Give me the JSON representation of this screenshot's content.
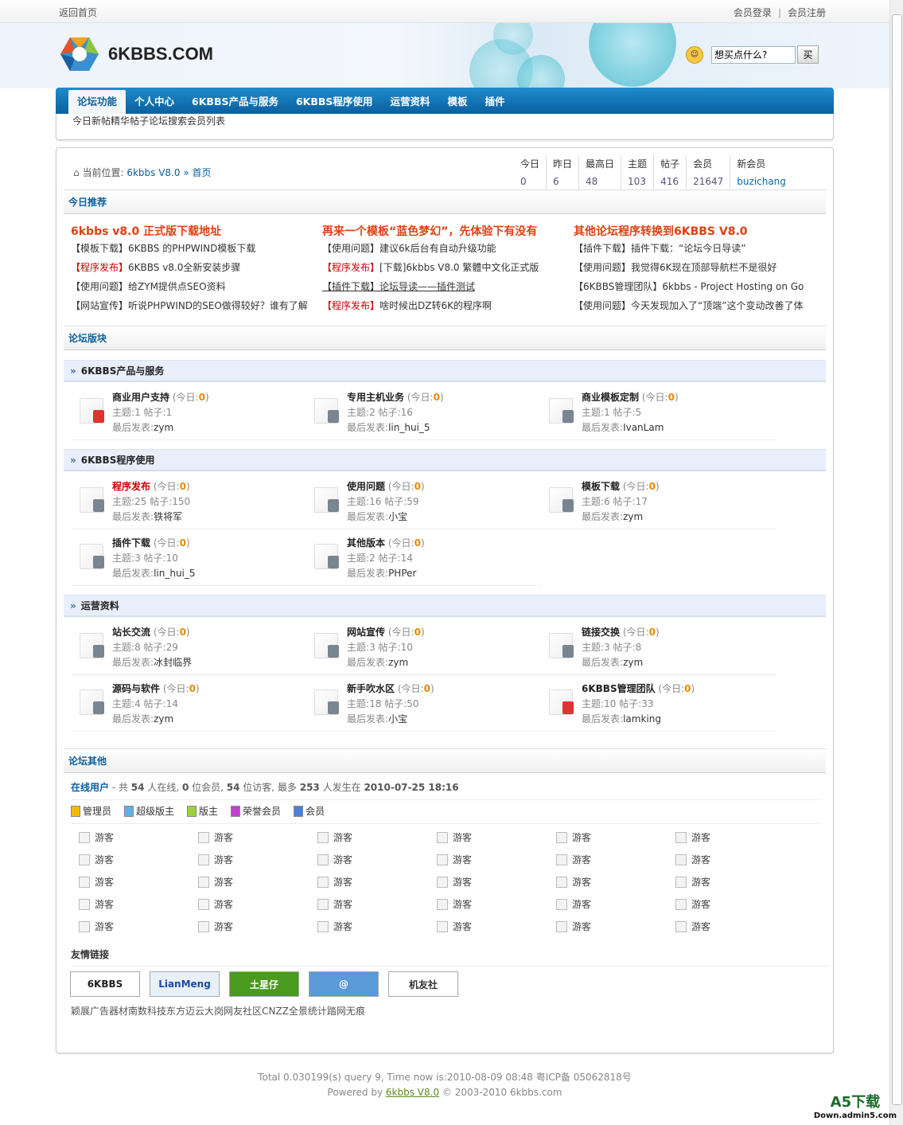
{
  "topbar": {
    "home": "返回首页",
    "login": "会员登录",
    "sep": "|",
    "register": "会员注册"
  },
  "logo": {
    "text": "6KBBS.COM"
  },
  "search": {
    "placeholder": "想买点什么?",
    "button": "买"
  },
  "nav": [
    "论坛功能",
    "个人中心",
    "6KBBS产品与服务",
    "6KBBS程序使用",
    "运营资料",
    "模板",
    "插件"
  ],
  "subnav": [
    "今日新帖",
    "精华帖子",
    "论坛搜索",
    "会员列表"
  ],
  "breadcrumb": {
    "label": "当前位置:",
    "site": "6kbbs V8.0",
    "sep": "»",
    "page": "首页"
  },
  "stats": [
    {
      "k": "今日",
      "v": "0"
    },
    {
      "k": "昨日",
      "v": "6"
    },
    {
      "k": "最高日",
      "v": "48"
    },
    {
      "k": "主题",
      "v": "103"
    },
    {
      "k": "帖子",
      "v": "416"
    },
    {
      "k": "会员",
      "v": "21647"
    },
    {
      "k": "新会员",
      "v": "buzichang"
    }
  ],
  "today_title": "今日推荐",
  "recommend": [
    {
      "title": "6kbbs v8.0 正式版下载地址",
      "items": [
        {
          "tag": "【模板下载】",
          "text": "6KBBS 的PHPWIND模板下载"
        },
        {
          "tag": "【程序发布】",
          "text": "6KBBS v8.0全新安装步骤",
          "red": true
        },
        {
          "tag": "【使用问题】",
          "text": "给ZYM提供点SEO资料"
        },
        {
          "tag": "【网站宣传】",
          "text": "听说PHPWIND的SEO做得较好？谁有了解"
        }
      ]
    },
    {
      "title": "再来一个模板“蓝色梦幻”，先体验下有没有",
      "items": [
        {
          "tag": "【使用问题】",
          "text": "建议6k后台有自动升级功能"
        },
        {
          "tag": "【程序发布】",
          "text": "[下载]6kbbs V8.0 繁體中文化正式版",
          "red": true
        },
        {
          "tag": "【插件下载】",
          "text": "论坛导读——插件测试",
          "ul": true
        },
        {
          "tag": "【程序发布】",
          "text": "啥时候出DZ转6K的程序啊",
          "red": true
        }
      ]
    },
    {
      "title": "其他论坛程序转换到6KBBS V8.0",
      "items": [
        {
          "tag": "【插件下载】",
          "text": "插件下载：“论坛今日导读”"
        },
        {
          "tag": "【使用问题】",
          "text": "我觉得6K现在顶部导航栏不是很好"
        },
        {
          "tag": "【6KBBS管理团队】",
          "text": "6kbbs - Project Hosting on Go"
        },
        {
          "tag": "【使用问题】",
          "text": "今天发现加入了“顶端”这个变动改善了体"
        }
      ]
    }
  ],
  "forums_title": "论坛版块",
  "labels": {
    "today": "今日",
    "topics": "主题",
    "posts": "帖子",
    "last": "最后发表"
  },
  "categories": [
    {
      "name": "6KBBS产品与服务",
      "forums": [
        {
          "name": "商业用户支持",
          "today": "0",
          "topics": "1",
          "posts": "1",
          "last": "zym",
          "locked": true
        },
        {
          "name": "专用主机业务",
          "today": "0",
          "topics": "2",
          "posts": "16",
          "last": "lin_hui_5"
        },
        {
          "name": "商业模板定制",
          "today": "0",
          "topics": "1",
          "posts": "5",
          "last": "IvanLam"
        }
      ]
    },
    {
      "name": "6KBBS程序使用",
      "forums": [
        {
          "name": "程序发布",
          "today": "0",
          "topics": "25",
          "posts": "150",
          "last": "铁将军",
          "red": true
        },
        {
          "name": "使用问题",
          "today": "0",
          "topics": "16",
          "posts": "59",
          "last": "小宝"
        },
        {
          "name": "模板下载",
          "today": "0",
          "topics": "6",
          "posts": "17",
          "last": "zym"
        },
        {
          "name": "插件下载",
          "today": "0",
          "topics": "3",
          "posts": "10",
          "last": "lin_hui_5"
        },
        {
          "name": "其他版本",
          "today": "0",
          "topics": "2",
          "posts": "14",
          "last": "PHPer"
        }
      ]
    },
    {
      "name": "运营资料",
      "forums": [
        {
          "name": "站长交流",
          "today": "0",
          "topics": "8",
          "posts": "29",
          "last": "冰封临界"
        },
        {
          "name": "网站宣传",
          "today": "0",
          "topics": "3",
          "posts": "10",
          "last": "zym"
        },
        {
          "name": "链接交换",
          "today": "0",
          "topics": "3",
          "posts": "8",
          "last": "zym"
        },
        {
          "name": "源码与软件",
          "today": "0",
          "topics": "4",
          "posts": "14",
          "last": "zym"
        },
        {
          "name": "新手吹水区",
          "today": "0",
          "topics": "18",
          "posts": "50",
          "last": "小宝"
        },
        {
          "name": "6KBBS管理团队",
          "today": "0",
          "topics": "10",
          "posts": "33",
          "last": "lamking",
          "locked": true
        }
      ]
    }
  ],
  "other_title": "论坛其他",
  "online": {
    "label": "在线用户",
    "p1": " - 共 ",
    "total": "54",
    "p2": " 人在线, ",
    "members": "0",
    "p3": " 位会员, ",
    "guests": "54",
    "p4": " 位访客, 最多 ",
    "max": "253",
    "p5": " 人发生在 ",
    "max_time": "2010-07-25 18:16"
  },
  "legend": [
    {
      "label": "管理员",
      "color": "#f5b800"
    },
    {
      "label": "超级版主",
      "color": "#5ab4e6"
    },
    {
      "label": "版主",
      "color": "#9cd040"
    },
    {
      "label": "荣誉会员",
      "color": "#c040d0"
    },
    {
      "label": "会员",
      "color": "#4a7ed8"
    }
  ],
  "guest_label": "游客",
  "guest_count": 30,
  "friend_title": "友情链接",
  "friend_logos": [
    {
      "text": "6KBBS",
      "bg": "#fff",
      "fg": "#222"
    },
    {
      "text": "LianMeng",
      "bg": "#e8f0f8",
      "fg": "#1a4aa0"
    },
    {
      "text": "土星仔",
      "bg": "#4a9a20",
      "fg": "#fff"
    },
    {
      "text": "@",
      "bg": "#5a9ad8",
      "fg": "#fff"
    },
    {
      "text": "机友社",
      "bg": "#fff",
      "fg": "#333"
    }
  ],
  "friend_names": [
    "颖展广告器材",
    "南数科技",
    "东方迈云",
    "大岗网友社区",
    "CNZZ全景统计",
    "踏网无痕"
  ],
  "footer": {
    "line1": "Total 0.030199(s) query 9, Time now is:2010-08-09 08:48 粤ICP备  05062818号",
    "powered": "Powered by ",
    "link": "6kbbs V8.0",
    "copy": " © 2003-2010 6kbbs.com"
  },
  "watermark": {
    "a": "A5下载",
    "b": "Down.admin5.com"
  }
}
